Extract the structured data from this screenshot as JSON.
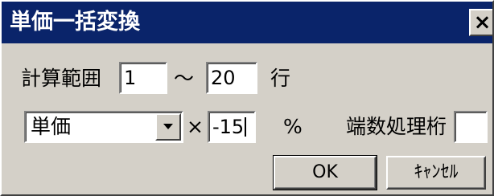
{
  "dialog": {
    "title": "単価一括変換",
    "close_label": "×"
  },
  "range": {
    "label": "計算範囲",
    "from_value": "1",
    "separator": "～",
    "to_value": "20",
    "unit": "行"
  },
  "conversion": {
    "field_selected": "単価",
    "multiply_symbol": "×",
    "percent_value": "-15",
    "percent_symbol": "%",
    "rounding_label": "端数処理桁",
    "rounding_value": ""
  },
  "buttons": {
    "ok": "OK",
    "cancel": "ｷｬﾝｾﾙ"
  },
  "icons": {
    "close": "close-icon",
    "dropdown": "chevron-down-icon"
  }
}
